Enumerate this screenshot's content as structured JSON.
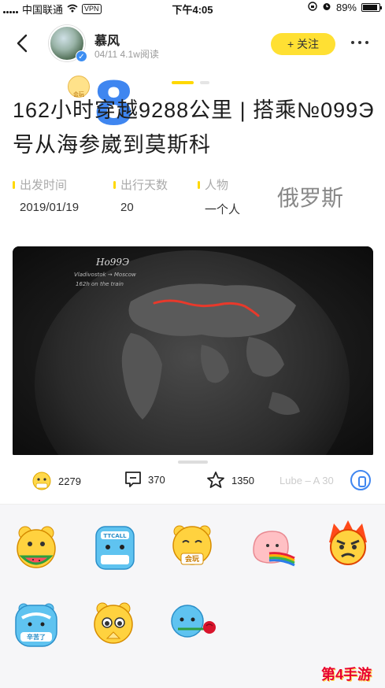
{
  "status_bar": {
    "carrier": "中国联通",
    "vpn": "VPN",
    "time": "下午4:05",
    "battery": "89%",
    "battery_level": 0.89
  },
  "header": {
    "author_name": "慕风",
    "meta": "04/11 4.1w阅读",
    "follow_label": "+ 关注",
    "follow_color": "#ffe033",
    "page_dot_colors": [
      "#ffd800",
      "#e5e5e5"
    ]
  },
  "overlay_number": "8",
  "article": {
    "title": "162小时穿越9288公里 | 搭乘№099Э号从海参崴到莫斯科"
  },
  "info": [
    {
      "label": "出发时间",
      "value": "2019/01/19"
    },
    {
      "label": "出行天数",
      "value": "20"
    },
    {
      "label": "人物",
      "value": "一个人"
    }
  ],
  "info_big_text": "俄罗斯",
  "map": {
    "handwriting_title": "Ho99Э",
    "handwriting_line2": "Vladivostok → Moscow",
    "handwriting_line3": "162h  on the train",
    "route_color": "#e8392b"
  },
  "actions": {
    "like_count": "2279",
    "comment_count": "370",
    "star_count": "1350",
    "faint_text": "Lube – A 30"
  },
  "emojis": [
    {
      "name": "watermelon-emoji"
    },
    {
      "name": "tcall-emoji"
    },
    {
      "name": "huiwan-emoji"
    },
    {
      "name": "peach-rainbow-emoji"
    },
    {
      "name": "angry-fire-emoji"
    },
    {
      "name": "xinkule-emoji"
    },
    {
      "name": "begging-emoji"
    },
    {
      "name": "rose-emoji"
    }
  ],
  "watermark": "第4手游"
}
